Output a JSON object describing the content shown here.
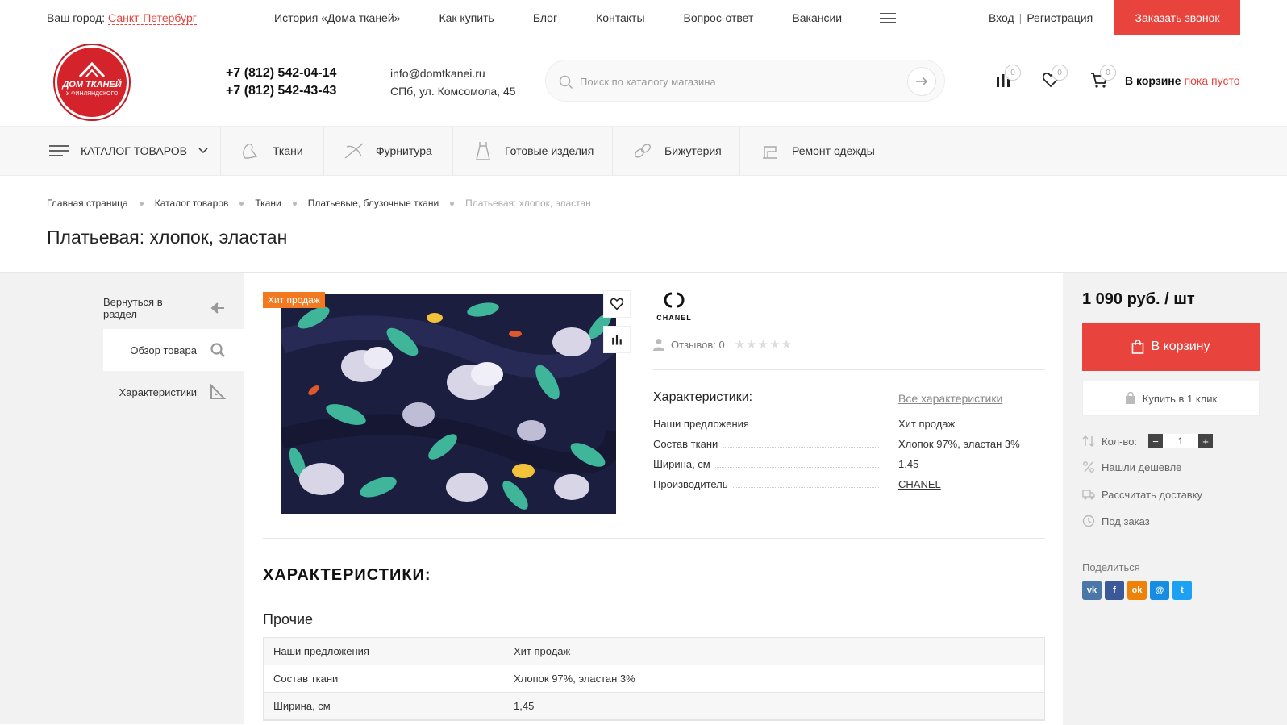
{
  "topbar": {
    "city_label": "Ваш город:",
    "city_value": "Санкт-Петербург",
    "nav": [
      "История «Дома тканей»",
      "Как купить",
      "Блог",
      "Контакты",
      "Вопрос-ответ",
      "Вакансии"
    ],
    "login": "Вход",
    "separator": "|",
    "register": "Регистрация",
    "call_button": "Заказать звонок"
  },
  "header": {
    "logo_line1": "ДОМ ТКАНЕЙ",
    "logo_line2": "У ФИНЛЯНДСКОГО",
    "phone1": "+7 (812) 542-04-14",
    "phone2": "+7 (812) 542-43-43",
    "email": "info@domtkanei.ru",
    "address": "СПб, ул. Комсомола, 45",
    "search_placeholder": "Поиск по каталогу магазина",
    "compare_count": "0",
    "favorites_count": "0",
    "cart_count": "0",
    "cart_label": "В корзине",
    "cart_status": "пока пусто"
  },
  "menu": {
    "catalog": "КАТАЛОГ ТОВАРОВ",
    "items": [
      "Ткани",
      "Фурнитура",
      "Готовые изделия",
      "Бижутерия",
      "Ремонт одежды"
    ]
  },
  "breadcrumbs": [
    "Главная страница",
    "Каталог товаров",
    "Ткани",
    "Платьевые, блузочные ткани",
    "Платьевая: хлопок, эластан"
  ],
  "page_title": "Платьевая: хлопок, эластан",
  "leftnav": [
    "Вернуться в раздел",
    "Обзор товара",
    "Характеристики"
  ],
  "product": {
    "badge": "Хит продаж",
    "brand": "CHANEL",
    "reviews": "Отзывов: 0",
    "char_title": "Характеристики:",
    "all_chars": "Все характеристики",
    "props": [
      {
        "k": "Наши предложения",
        "v": "Хит продаж"
      },
      {
        "k": "Состав ткани",
        "v": "Хлопок 97%, эластан 3%"
      },
      {
        "k": "Ширина, см",
        "v": "1,45"
      },
      {
        "k": "Производитель",
        "v": "CHANEL"
      }
    ],
    "section_title": "ХАРАКТЕРИСТИКИ:",
    "group_title": "Прочие",
    "table": [
      {
        "k": "Наши предложения",
        "v": "Хит продаж"
      },
      {
        "k": "Состав ткани",
        "v": "Хлопок 97%, эластан 3%"
      },
      {
        "k": "Ширина, см",
        "v": "1,45"
      }
    ]
  },
  "buy": {
    "price": "1 090 руб. / шт",
    "to_cart": "В корзину",
    "one_click": "Купить в 1 клик",
    "qty_label": "Кол-во:",
    "qty_value": "1",
    "minus": "−",
    "plus": "+",
    "cheaper": "Нашли дешевле",
    "delivery": "Рассчитать доставку",
    "order": "Под заказ",
    "share": "Поделиться"
  },
  "colors": {
    "accent": "#e8433d",
    "badge": "#f2791f",
    "logo": "#d5232b"
  },
  "socials": [
    {
      "name": "vk-icon",
      "label": "vk",
      "color": "#4a76a8"
    },
    {
      "name": "facebook-icon",
      "label": "f",
      "color": "#3b5998"
    },
    {
      "name": "odnoklassniki-icon",
      "label": "ok",
      "color": "#ee8208"
    },
    {
      "name": "moimir-icon",
      "label": "@",
      "color": "#168de2"
    },
    {
      "name": "twitter-icon",
      "label": "t",
      "color": "#1da1f2"
    }
  ]
}
